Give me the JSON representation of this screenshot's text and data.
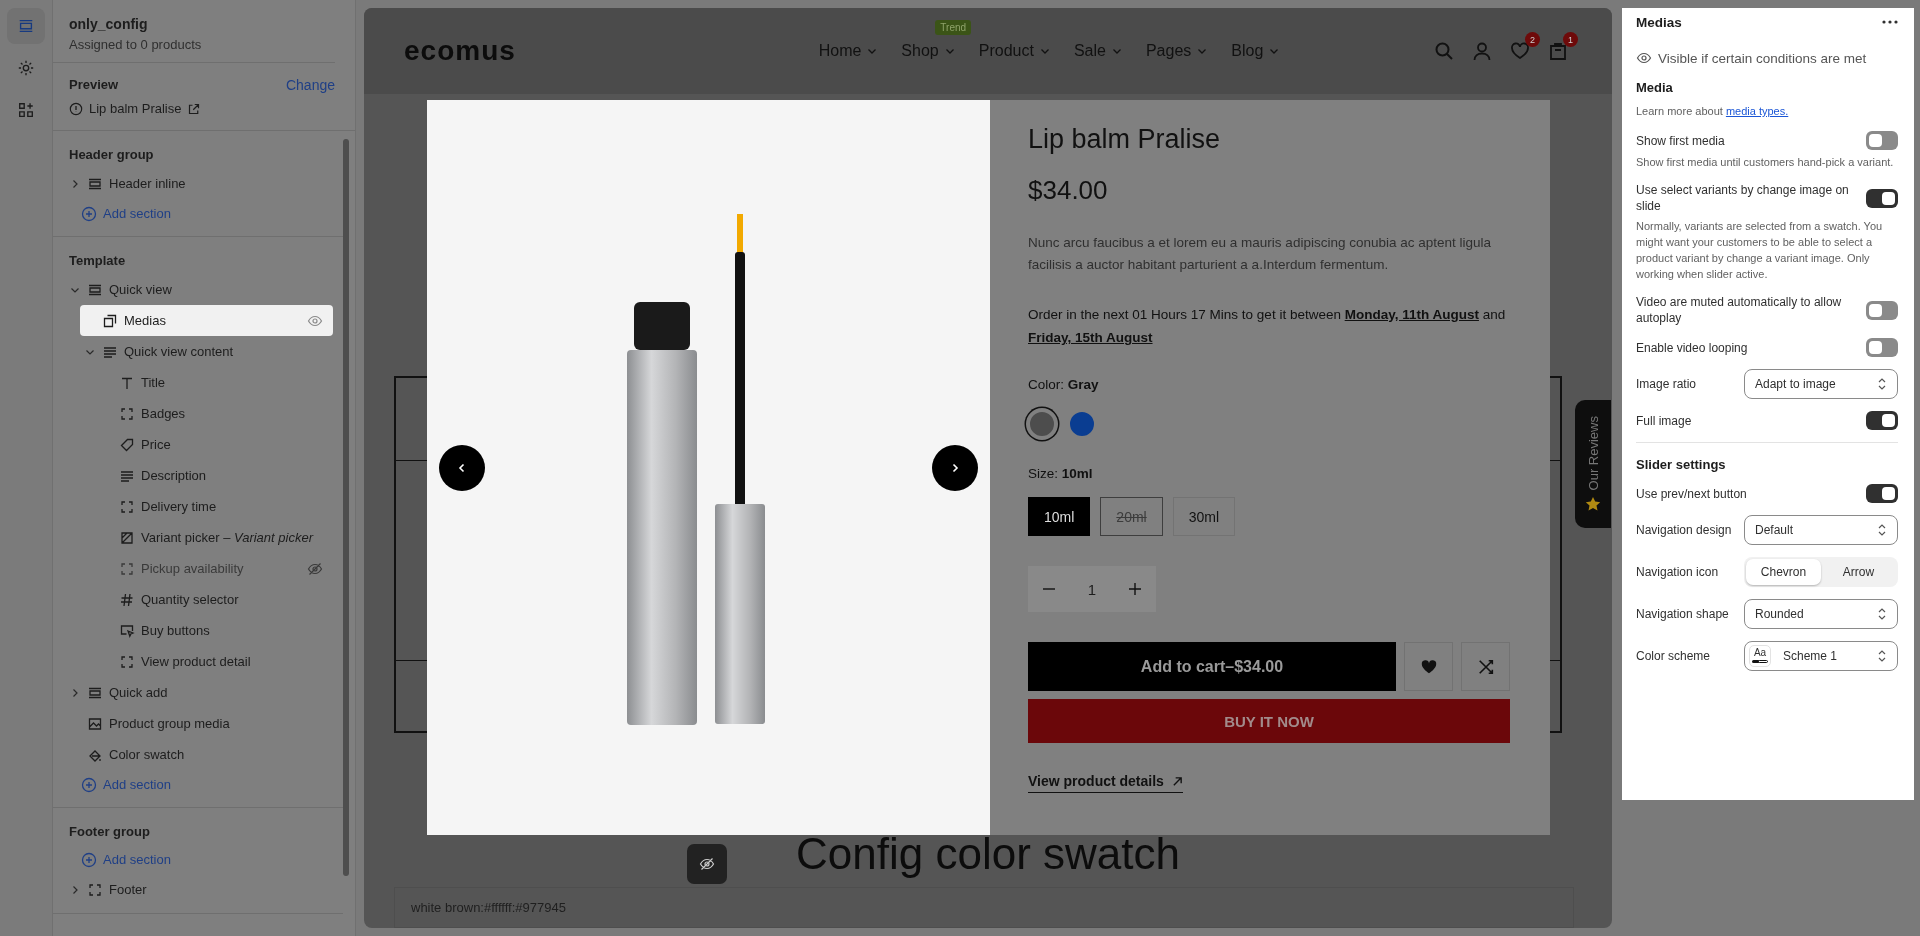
{
  "rail": [
    {
      "kind": "sections",
      "selected": true
    },
    {
      "kind": "settings",
      "selected": false
    },
    {
      "kind": "apps",
      "selected": false
    }
  ],
  "sidebar": {
    "template_name": "only_config",
    "assigned": "Assigned to 0 products",
    "preview_label": "Preview",
    "change_link": "Change",
    "preview_product": "Lip balm Pralise",
    "groups": [
      {
        "title": "Header group",
        "entries": [
          {
            "kind": "section",
            "label": "Header inline",
            "expanded": false,
            "selected": false,
            "hidden": false
          },
          {
            "kind": "add",
            "label": "Add section"
          }
        ]
      },
      {
        "title": "Template",
        "entries": [
          {
            "kind": "section",
            "label": "Quick view",
            "expanded": true,
            "selected": false,
            "hidden": false,
            "children": [
              {
                "kind": "media",
                "label": "Medias",
                "selected": true,
                "hidden": false
              },
              {
                "kind": "lines",
                "label": "Quick view content",
                "expanded": true,
                "selected": false,
                "hidden": false,
                "children": [
                  {
                    "kind": "text",
                    "label": "Title",
                    "selected": false,
                    "hidden": false
                  },
                  {
                    "kind": "dashed",
                    "label": "Badges",
                    "selected": false,
                    "hidden": false
                  },
                  {
                    "kind": "price",
                    "label": "Price",
                    "selected": false,
                    "hidden": false
                  },
                  {
                    "kind": "lines",
                    "label": "Description",
                    "selected": false,
                    "hidden": false
                  },
                  {
                    "kind": "dashed",
                    "label": "Delivery time",
                    "selected": false,
                    "hidden": false
                  },
                  {
                    "kind": "variant",
                    "label": "Variant picker – *Variant picker*",
                    "selected": false,
                    "hidden": false
                  },
                  {
                    "kind": "dashed",
                    "label": "Pickup availability",
                    "selected": false,
                    "hidden": true
                  },
                  {
                    "kind": "hash",
                    "label": "Quantity selector",
                    "selected": false,
                    "hidden": false
                  },
                  {
                    "kind": "cursor",
                    "label": "Buy buttons",
                    "selected": false,
                    "hidden": false
                  },
                  {
                    "kind": "dashed",
                    "label": "View product detail",
                    "selected": false,
                    "hidden": false
                  }
                ]
              }
            ]
          },
          {
            "kind": "section",
            "label": "Quick add",
            "expanded": false,
            "selected": false,
            "hidden": false
          },
          {
            "kind": "image",
            "label": "Product group media",
            "selected": false,
            "hidden": false
          },
          {
            "kind": "swatch",
            "label": "Color swatch",
            "selected": false,
            "hidden": false
          },
          {
            "kind": "add",
            "label": "Add section"
          }
        ]
      },
      {
        "title": "Footer group",
        "entries": [
          {
            "kind": "add",
            "label": "Add section"
          },
          {
            "kind": "dashed",
            "label": "Footer",
            "expanded": false,
            "selected": false,
            "hidden": false
          }
        ]
      }
    ]
  },
  "store": {
    "logo": "ecomus",
    "nav": [
      {
        "label": "Home"
      },
      {
        "label": "Shop",
        "badge": "Trend"
      },
      {
        "label": "Product"
      },
      {
        "label": "Sale"
      },
      {
        "label": "Pages"
      },
      {
        "label": "Blog"
      }
    ],
    "wishlist_count": "2",
    "cart_count": "1"
  },
  "page": {
    "heading": "Config color swatch",
    "field_text": "white brown:#ffffff:#977945",
    "reviews_tab": "Our Reviews"
  },
  "quick_view": {
    "title": "Lip balm Pralise",
    "price": "$34.00",
    "description": "Nunc arcu faucibus a et lorem eu a mauris adipiscing conubia ac aptent ligula facilisis a auctor habitant parturient a a.Interdum fermentum.",
    "delivery": "Order in the next 01 Hours 17 Mins to get it between **Monday, 11th August** and **Friday, 15th August**",
    "color_label": "Color:",
    "color_value": "Gray",
    "swatches": [
      {
        "color": "#4d4d4d",
        "selected": true
      },
      {
        "color": "#0a3d91",
        "selected": false
      }
    ],
    "size_label": "Size:",
    "size_value": "10ml",
    "sizes": [
      {
        "label": "10ml",
        "selected": true,
        "available": true
      },
      {
        "label": "20ml",
        "selected": false,
        "available": false
      },
      {
        "label": "30ml",
        "selected": false,
        "available": true
      }
    ],
    "quantity": "1",
    "add_to_cart": "Add to cart–$34.00",
    "buy_now": "BUY IT NOW",
    "view_details": "View product details"
  },
  "panel": {
    "title": "Medias",
    "visibility": "Visible if certain conditions are met",
    "sections": [
      {
        "title": "Media",
        "intro": "Learn more about",
        "intro_link": "media types.",
        "settings": [
          {
            "kind": "toggle",
            "label": "Show first media",
            "on": false,
            "help": "Show first media until customers hand-pick a variant."
          },
          {
            "kind": "toggle",
            "label": "Use select variants by change image on slide",
            "on": true,
            "help": "Normally, variants are selected from a swatch. You might want your customers to be able to select a product variant by change a variant image. Only working when slider active."
          },
          {
            "kind": "toggle",
            "label": "Video are muted automatically to allow autoplay",
            "on": false
          },
          {
            "kind": "toggle",
            "label": "Enable video looping",
            "on": false
          },
          {
            "kind": "select",
            "label": "Image ratio",
            "value": "Adapt to image"
          },
          {
            "kind": "toggle",
            "label": "Full image",
            "on": true
          }
        ]
      },
      {
        "title": "Slider settings",
        "settings": [
          {
            "kind": "toggle",
            "label": "Use prev/next button",
            "on": true
          },
          {
            "kind": "select",
            "label": "Navigation design",
            "value": "Default"
          },
          {
            "kind": "segmented",
            "label": "Navigation icon",
            "options": [
              {
                "label": "Chevron",
                "selected": true
              },
              {
                "label": "Arrow",
                "selected": false
              }
            ]
          },
          {
            "kind": "select",
            "label": "Navigation shape",
            "value": "Rounded"
          },
          {
            "kind": "scheme",
            "label": "Color scheme",
            "value": "Scheme 1",
            "swatch_text": "Aa"
          }
        ]
      }
    ]
  }
}
